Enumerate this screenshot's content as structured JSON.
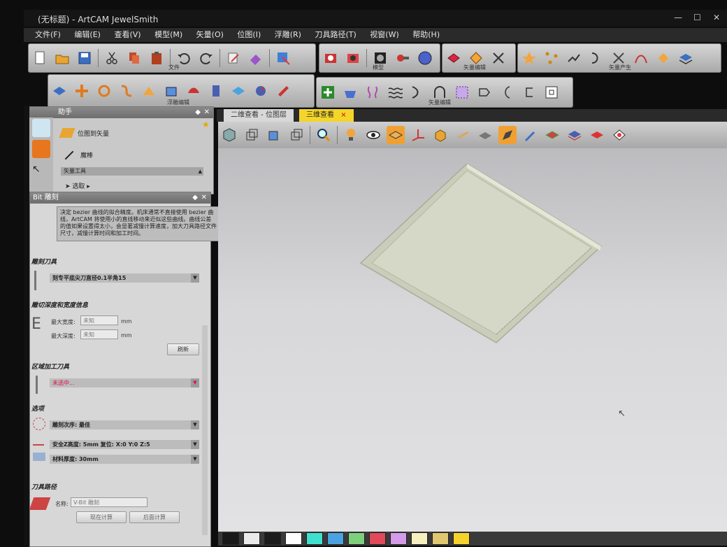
{
  "app": {
    "title": "(无标题) - ArtCAM JewelSmith",
    "win_buttons": [
      "—",
      "☐",
      "✕"
    ]
  },
  "menu": [
    "文件(F)",
    "编辑(E)",
    "查看(V)",
    "模型(M)",
    "矢量(O)",
    "位图(I)",
    "浮雕(R)",
    "刀具路径(T)",
    "视窗(W)",
    "帮助(H)"
  ],
  "toolbar_groups": {
    "file": "文件",
    "model": "模型",
    "vector_edit": "矢量编辑",
    "vector_create": "矢量产生",
    "relief_edit": "浮雕编辑",
    "vector_edit2": "矢量编辑"
  },
  "assistant": {
    "title": "助手",
    "item1": "位图到矢量",
    "item2": "魔棒",
    "section": "矢量工具",
    "item3": "选取 ▸"
  },
  "bitpanel": {
    "title": "Bit 雕刻",
    "note": "决定 bezier 曲线的拟合精度。机床通常不直接使用 bezier 曲线，ArtCAM 将使用小的直线移动来近似这些曲线。曲线公差的值如果设置得太小，会显著减慢计算速度，加大刀具路径文件尺寸，减慢计算时间和加工时间。",
    "sec_tool": "雕刻刀具",
    "tool_value": "刻专平底尖刀直径0.1半角15",
    "sec_depth": "雕切深度和宽度信息",
    "max_width_label": "最大宽度:",
    "max_width_value": "未知",
    "max_depth_label": "最大深度:",
    "max_depth_value": "未知",
    "unit": "mm",
    "refresh": "刷新",
    "sec_area": "区域加工刀具",
    "area_value": "未选中...",
    "sec_options": "选项",
    "order": "雕刻次序: 最佳",
    "safez": "安全Z高度: 5mm 复位: X:0 Y:0 Z:5",
    "thickness": "材料厚度: 30mm",
    "sec_path": "刀具路径",
    "name_label": "名称:",
    "name_value": "V-Bit 雕刻",
    "btn_now": "现在计算",
    "btn_later": "后面计算"
  },
  "tabs": {
    "tab1": "二维查看 - 位图层",
    "tab2": "三维查看",
    "close": "×"
  },
  "palette": [
    "#1a1a1a",
    "#eaeaea",
    "#1c1c1c",
    "#ffffff",
    "#40e0d0",
    "#4aa3e0",
    "#7ed07e",
    "#e04a5a",
    "#d39be8",
    "#f6efc0",
    "#e0c870",
    "#f6d32a"
  ]
}
